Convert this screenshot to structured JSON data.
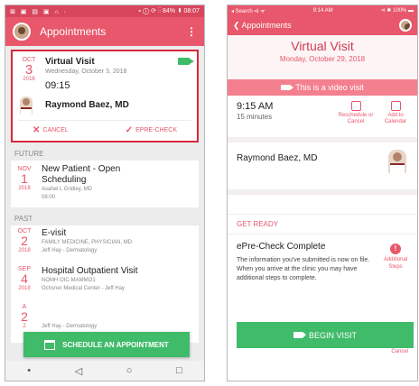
{
  "left": {
    "status": {
      "left": "⊠ ▣ ▤ ▣ ⌂ ·",
      "right": "⬩ ⓘ ⟳ ⁝⁝ 84% ▮ 08:07"
    },
    "appbar": {
      "title": "Appointments",
      "menu": "⋮"
    },
    "upcoming": {
      "month": "OCT",
      "day": "3",
      "year": "2018",
      "title": "Virtual Visit",
      "date": "Wednesday, October 3, 2018",
      "time": "09:15",
      "provider": "Raymond Baez, MD",
      "cancel": "CANCEL",
      "echeck": "EPRE-CHECK"
    },
    "future_label": "FUTURE",
    "future": {
      "month": "NOV",
      "day": "1",
      "year": "2018",
      "title1": "New Patient - Open",
      "title2": "Scheduling",
      "provider": "Asahel L Gridley, MD",
      "time": "08:00"
    },
    "past_label": "PAST",
    "past": [
      {
        "month": "OCT",
        "day": "2",
        "year": "2018",
        "title": "E-visit",
        "l1": "FAMILY MEDICINE, PHYSICIAN, MD",
        "l2": "Jeff Hay - Dermatology"
      },
      {
        "month": "SEP",
        "day": "4",
        "year": "2018",
        "title": "Hospital Outpatient Visit",
        "l1": "NOMH OIC-MAMMO1",
        "l2": "Ochsner Medical Center - Jeff Hay"
      },
      {
        "month": "A",
        "day": "2",
        "year": "2",
        "title": "",
        "l1": "",
        "l2": "Jeff Hay - Dermatology"
      }
    ],
    "fab": "SCHEDULE AN APPOINTMENT",
    "nav": {
      "back": "◁",
      "home": "○",
      "recent": "□",
      "dot": "•"
    }
  },
  "right": {
    "status": {
      "left": "◂ Search ▪ıl ᯤ",
      "center": "9:14 AM",
      "right": "⊲ ✱ 100% ▬"
    },
    "nav": {
      "back": "❮ Appointments"
    },
    "hero": {
      "title": "Virtual Visit",
      "date": "Monday, October 29, 2018"
    },
    "banner": "This is a video visit",
    "time": "9:15 AM",
    "duration": "15 minutes",
    "reschedule": "Reschedule or Cancel",
    "calendar": "Add to Calendar",
    "provider": "Raymond Baez, MD",
    "getready": "GET READY",
    "epre": {
      "title": "ePre-Check Complete",
      "body": "The information you've submitted is now on file. When you arrive at the clinic you may have additional steps to complete.",
      "more": "Additional Steps",
      "more_icon": "!"
    },
    "begin": "BEGIN VISIT",
    "cancel_peek": "Cancel"
  }
}
